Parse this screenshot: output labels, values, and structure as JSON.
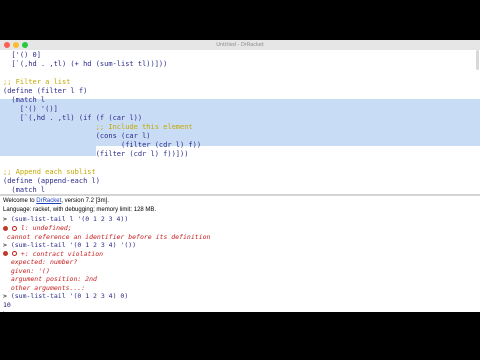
{
  "window": {
    "title": "Untitled - DrRacket"
  },
  "definitions": {
    "lines": [
      "  ['() 0]",
      "  [`(,hd . ,tl) (+ hd (sum-list tl))]))",
      "",
      ";; Filter a list",
      "(define (filter l f)",
      "  (match l",
      "    ['() '()]",
      "    [`(,hd . ,tl) (if (f (car l))",
      "                      ;; Include this element",
      "                      (cons (car l)",
      "                            (filter (cdr l) f))",
      "                      (filter (cdr l) f))]))",
      "",
      ";; Append each sublist",
      "(define (append-each l)",
      "  (match l",
      "    ['() '()]"
    ]
  },
  "repl": {
    "banner_line1_pre": "Welcome to ",
    "banner_link": "DrRacket",
    "banner_line1_post": ", version 7.2 [3m].",
    "banner_line2": "Language: racket, with debugging; memory limit: 128 MB.",
    "prompt": ">",
    "input1": "(sum-list-tail l '(0 1 2 3 4))",
    "err1_line1": "l: undefined;",
    "err1_line2": " cannot reference an identifier before its definition",
    "input2": "(sum-list-tail '(0 1 2 3 4) '())",
    "err2_line1": "+: contract violation",
    "err2_line2": "  expected: number?",
    "err2_line3": "  given: '()",
    "err2_line4": "  argument position: 2nd",
    "err2_line5": "  other arguments...:",
    "input3": "(sum-list-tail '(0 1 2 3 4) 0)",
    "result3": "10",
    "prompt_empty": ">"
  },
  "colors": {
    "selection": "#c9dcf6",
    "comment": "#c2a800",
    "error": "#c61a1a",
    "code": "#2a2a8a"
  }
}
